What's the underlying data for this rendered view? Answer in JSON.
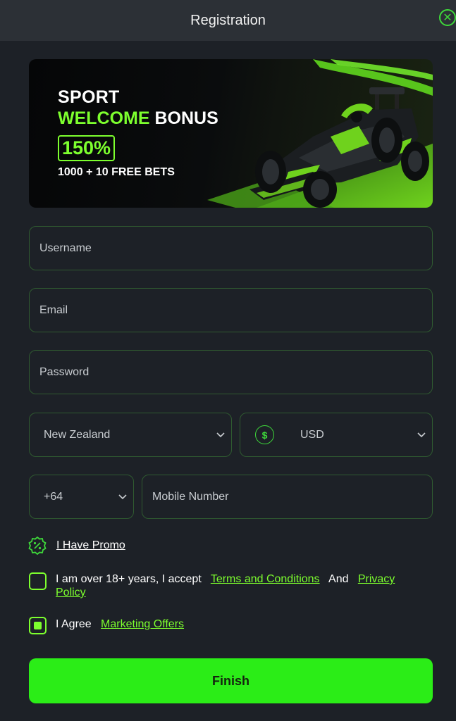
{
  "header": {
    "title": "Registration",
    "close_icon": "close-circle-icon"
  },
  "banner": {
    "line1": "SPORT",
    "line2_green": "WELCOME",
    "line2_white": "BONUS",
    "percent": "150%",
    "subtitle": "1000 + 10 FREE BETS"
  },
  "form": {
    "username_placeholder": "Username",
    "email_placeholder": "Email",
    "password_placeholder": "Password",
    "country": "New Zealand",
    "currency": "USD",
    "phone_code": "+64",
    "mobile_placeholder": "Mobile Number"
  },
  "promo": {
    "label": "I Have Promo",
    "icon": "percent-badge-icon"
  },
  "consent": {
    "age_text": "I am over 18+ years, I accept",
    "terms_link": "Terms and Conditions",
    "and": "And",
    "privacy_link_1": "Privacy",
    "privacy_link_2": "Policy",
    "age_checked": false,
    "agree_text": "I Agree",
    "marketing_link": "Marketing Offers",
    "agree_checked": true
  },
  "finish_label": "Finish",
  "colors": {
    "accent": "#7dff2e",
    "button": "#2bed17",
    "background": "#1d2127",
    "header": "#2c3036"
  }
}
